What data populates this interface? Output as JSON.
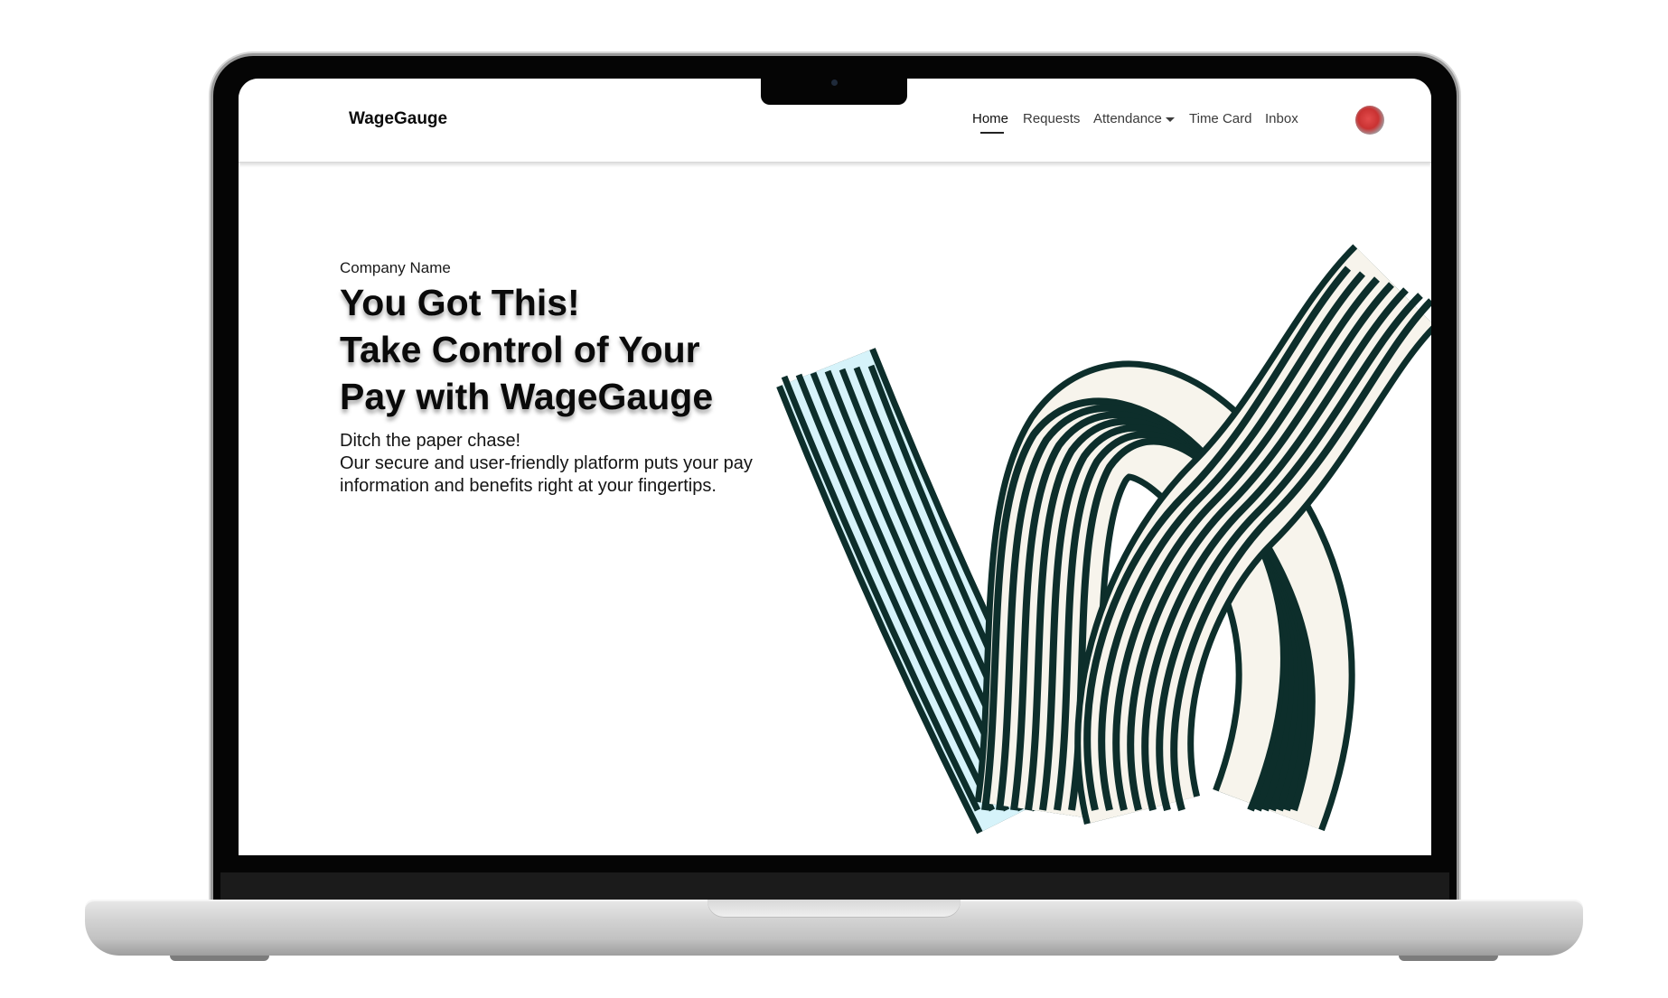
{
  "app": {
    "brand": "WageGauge"
  },
  "nav": {
    "items": [
      {
        "label": "Home",
        "active": true
      },
      {
        "label": "Requests",
        "active": false
      },
      {
        "label": "Attendance",
        "active": false,
        "has_dropdown": true
      },
      {
        "label": "Time Card",
        "active": false
      },
      {
        "label": "Inbox",
        "active": false
      }
    ],
    "avatar_icon": "user-avatar"
  },
  "hero": {
    "eyebrow": "Company Name",
    "title_lines": [
      "You Got This!",
      "Take Control of Your",
      "Pay with WageGauge"
    ],
    "body_lines": [
      "Ditch the paper chase!",
      "Our secure and user-friendly platform puts your pay",
      "information and benefits right at your fingertips."
    ]
  },
  "colors": {
    "ribbon_stripe": "#0d2e2b",
    "ribbon_light": "#f7f4ec",
    "ribbon_back": "#d6f3fa",
    "text_primary": "#0a0a0a"
  }
}
